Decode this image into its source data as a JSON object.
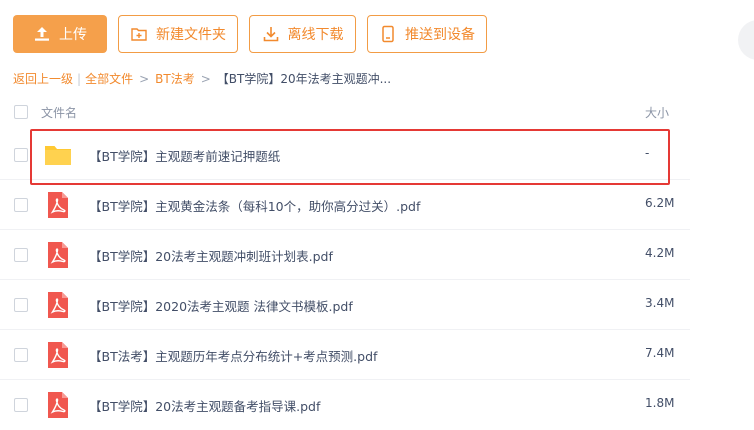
{
  "toolbar": {
    "upload_label": "上传",
    "new_folder_label": "新建文件夹",
    "offline_download_label": "离线下载",
    "push_device_label": "推送到设备"
  },
  "breadcrumb": {
    "back": "返回上一级",
    "all_files": "全部文件",
    "level1": "BT法考",
    "current": "【BT学院】20年法考主观题冲..."
  },
  "list": {
    "header_name": "文件名",
    "header_size": "大小",
    "items": [
      {
        "type": "folder-icon",
        "name": "【BT学院】主观题考前速记押题纸",
        "size": "-"
      },
      {
        "type": "pdf-icon",
        "name": "【BT学院】主观黄金法条（每科10个，助你高分过关）.pdf",
        "size": "6.2M"
      },
      {
        "type": "pdf-icon",
        "name": "【BT学院】20法考主观题冲刺班计划表.pdf",
        "size": "4.2M"
      },
      {
        "type": "pdf-icon",
        "name": "【BT学院】2020法考主观题 法律文书模板.pdf",
        "size": "3.4M"
      },
      {
        "type": "pdf-icon",
        "name": "【BT法考】主观题历年考点分布统计+考点预测.pdf",
        "size": "7.4M"
      },
      {
        "type": "pdf-icon",
        "name": "【BT学院】20法考主观题备考指导课.pdf",
        "size": "1.8M"
      }
    ]
  },
  "colors": {
    "accent": "#f5a04b",
    "accent_text": "#f28a2e",
    "highlight_border": "#e53935",
    "pdf_red": "#f0574f",
    "folder_yellow": "#ffcc3d"
  }
}
